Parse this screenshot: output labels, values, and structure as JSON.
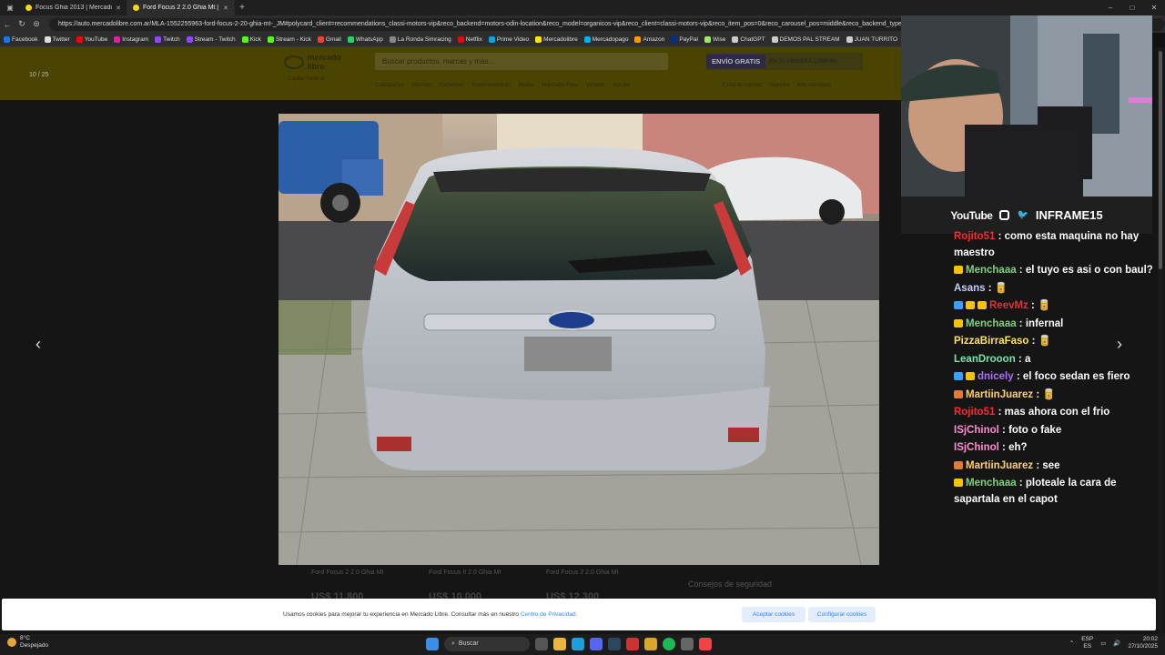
{
  "tabs": [
    {
      "label": "Focus Ghia 2013 | Mercado Libre",
      "active": false
    },
    {
      "label": "Ford Focus 2 2.0 Ghia Mt | Merca",
      "active": true
    }
  ],
  "window_controls": {
    "minimize": "–",
    "maximize": "□",
    "close": "✕"
  },
  "address_bar": {
    "url": "https://auto.mercadolibre.com.ar/MLA-1552255963-ford-focus-2-20-ghia-mt-_JM#polycard_client=recommendations_classi-motors-vip&reco_backend=motors-odin-location&reco_model=organicos-vip&reco_client=classi-motors-vip&reco_item_pos=0&reco_carousel_pos=middle&reco_backend_type"
  },
  "bookmarks": [
    {
      "label": "Facebook",
      "color": "#1877f2"
    },
    {
      "label": "Twitter",
      "color": "#dddddd"
    },
    {
      "label": "YouTube",
      "color": "#ff0000"
    },
    {
      "label": "Instagram",
      "color": "#d6249f"
    },
    {
      "label": "Twitch",
      "color": "#9146ff"
    },
    {
      "label": "Stream - Twitch",
      "color": "#9146ff"
    },
    {
      "label": "Kick",
      "color": "#53fc18"
    },
    {
      "label": "Stream - Kick",
      "color": "#53fc18"
    },
    {
      "label": "Gmail",
      "color": "#ea4335"
    },
    {
      "label": "WhatsApp",
      "color": "#25d366"
    },
    {
      "label": "La Ronda Simracing",
      "color": "#888888"
    },
    {
      "label": "Netflix",
      "color": "#e50914"
    },
    {
      "label": "Prime Video",
      "color": "#00a8e1"
    },
    {
      "label": "Mercadolibre",
      "color": "#ffe600"
    },
    {
      "label": "Mercadopago",
      "color": "#00b1ea"
    },
    {
      "label": "Amazon",
      "color": "#ff9900"
    },
    {
      "label": "PayPal",
      "color": "#003087"
    },
    {
      "label": "Wise",
      "color": "#9fe870"
    },
    {
      "label": "ChatGPT",
      "color": "#cccccc"
    },
    {
      "label": "DEMOS PAL STREAM",
      "color": "#cccccc"
    },
    {
      "label": "JUAN TURRITO",
      "color": "#cccccc"
    }
  ],
  "ml_header": {
    "logo_text": "mercado libre",
    "search_placeholder": "Buscar productos, marcas y más...",
    "envio_badge": "ENVÍO GRATIS",
    "envio_sub": "EN TU PRIMERA COMPRA",
    "location": "Capital Federal",
    "nav": [
      "Categorías",
      "Ofertas",
      "Cupones",
      "Supermercado",
      "Moda",
      "Mercado Play",
      "Vender",
      "Ayuda"
    ],
    "user_nav": [
      "Creá tu cuenta",
      "Ingresá",
      "Mis compras"
    ]
  },
  "gallery": {
    "counter": "10 / 25",
    "prev": "‹",
    "next": "›"
  },
  "related": [
    {
      "title": "Ford Focus 2 2.0 Ghia Mt",
      "price": "US$ 11.800"
    },
    {
      "title": "Ford Focus II 2.0 Ghia Mt",
      "price": "US$ 10.000"
    },
    {
      "title": "Ford Focus 2 2.0 Ghia Mt",
      "price": "US$ 12.300"
    }
  ],
  "security_tips": "Consejos de seguridad",
  "cookie_banner": {
    "text": "Usamos cookies para mejorar tu experiencia en Mercado Libre. Consultar más en nuestro",
    "link": "Centro de Privacidad.",
    "accept": "Aceptar cookies",
    "configure": "Configurar cookies"
  },
  "stream_overlay": {
    "youtube": "YouTube",
    "handle": "INFRAME15"
  },
  "chat": [
    {
      "user": "Rojito51",
      "color": "#ff2a2a",
      "text": "como esta maquina no hay maestro",
      "badges": []
    },
    {
      "user": "Menchaaa",
      "color": "#7fd07f",
      "text": "el tuyo es asi o con baul?",
      "badges": [
        "#f5c400"
      ]
    },
    {
      "user": "Asans",
      "color": "#c9c9ff",
      "text": "🥫",
      "badges": []
    },
    {
      "user": "ReevMz",
      "color": "#e0303a",
      "text": "🥫",
      "badges": [
        "#3aa0ff",
        "#f5c400",
        "#f5c400"
      ]
    },
    {
      "user": "Menchaaa",
      "color": "#7fd07f",
      "text": "infernal",
      "badges": [
        "#f5c400"
      ]
    },
    {
      "user": "PizzaBirraFaso",
      "color": "#ffe066",
      "text": "🥫",
      "badges": []
    },
    {
      "user": "LeanDrooon",
      "color": "#7fe0b0",
      "text": "a",
      "badges": []
    },
    {
      "user": "dnicely",
      "color": "#a970ff",
      "text": "el foco sedan es fiero",
      "badges": [
        "#3aa0ff",
        "#f5c400"
      ]
    },
    {
      "user": "MartiinJuarez",
      "color": "#ffcf6b",
      "text": "🥫",
      "badges": [
        "#e07a3a"
      ]
    },
    {
      "user": "Rojito51",
      "color": "#ff2a2a",
      "text": "mas ahora con el frio",
      "badges": []
    },
    {
      "user": "ISjChinol",
      "color": "#ff8ad0",
      "text": "foto o fake",
      "badges": []
    },
    {
      "user": "ISjChinol",
      "color": "#ff8ad0",
      "text": "eh?",
      "badges": []
    },
    {
      "user": "MartiinJuarez",
      "color": "#ffcf6b",
      "text": "see",
      "badges": [
        "#e07a3a"
      ]
    },
    {
      "user": "Menchaaa",
      "color": "#7fd07f",
      "text": "ploteale la cara de sapartala en el capot",
      "badges": [
        "#f5c400"
      ]
    }
  ],
  "taskbar": {
    "weather_temp": "8°C",
    "weather_desc": "Despejado",
    "search": "Buscar",
    "lang_top": "ESP",
    "lang_bottom": "ES",
    "time": "20:02",
    "date": "27/10/2025"
  }
}
